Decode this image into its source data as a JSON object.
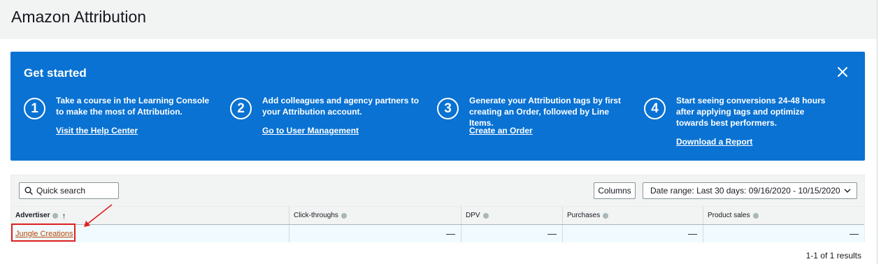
{
  "page": {
    "title": "Amazon Attribution"
  },
  "banner": {
    "title": "Get started",
    "steps": [
      {
        "num": "1",
        "text": "Take a course in the Learning Console to make the most of Attribution.",
        "link": "Visit the Help Center"
      },
      {
        "num": "2",
        "text": "Add colleagues and agency partners to your Attribution account.",
        "link": "Go to User Management"
      },
      {
        "num": "3",
        "text": "Generate your Attribution tags by first creating an Order, followed by Line Items.",
        "link": "Create an Order"
      },
      {
        "num": "4",
        "text": "Start seeing conversions 24-48 hours after applying tags and optimize towards best performers.",
        "link": "Download a Report"
      }
    ]
  },
  "toolbar": {
    "search_placeholder": "Quick search",
    "columns_label": "Columns",
    "date_range_label": "Date range:",
    "date_range_value": "Last 30 days: 09/16/2020 - 10/15/2020"
  },
  "table": {
    "columns": [
      "Advertiser",
      "Click-throughs",
      "DPV",
      "Purchases",
      "Product sales"
    ],
    "rows": [
      {
        "advertiser": "Jungle Creations",
        "click_throughs": "—",
        "dpv": "—",
        "purchases": "—",
        "product_sales": "—"
      }
    ]
  },
  "pagination": {
    "results_text": "1-1 of 1 results"
  },
  "colors": {
    "banner": "#0972d3",
    "link": "#b54708",
    "annotation": "#e02020"
  }
}
